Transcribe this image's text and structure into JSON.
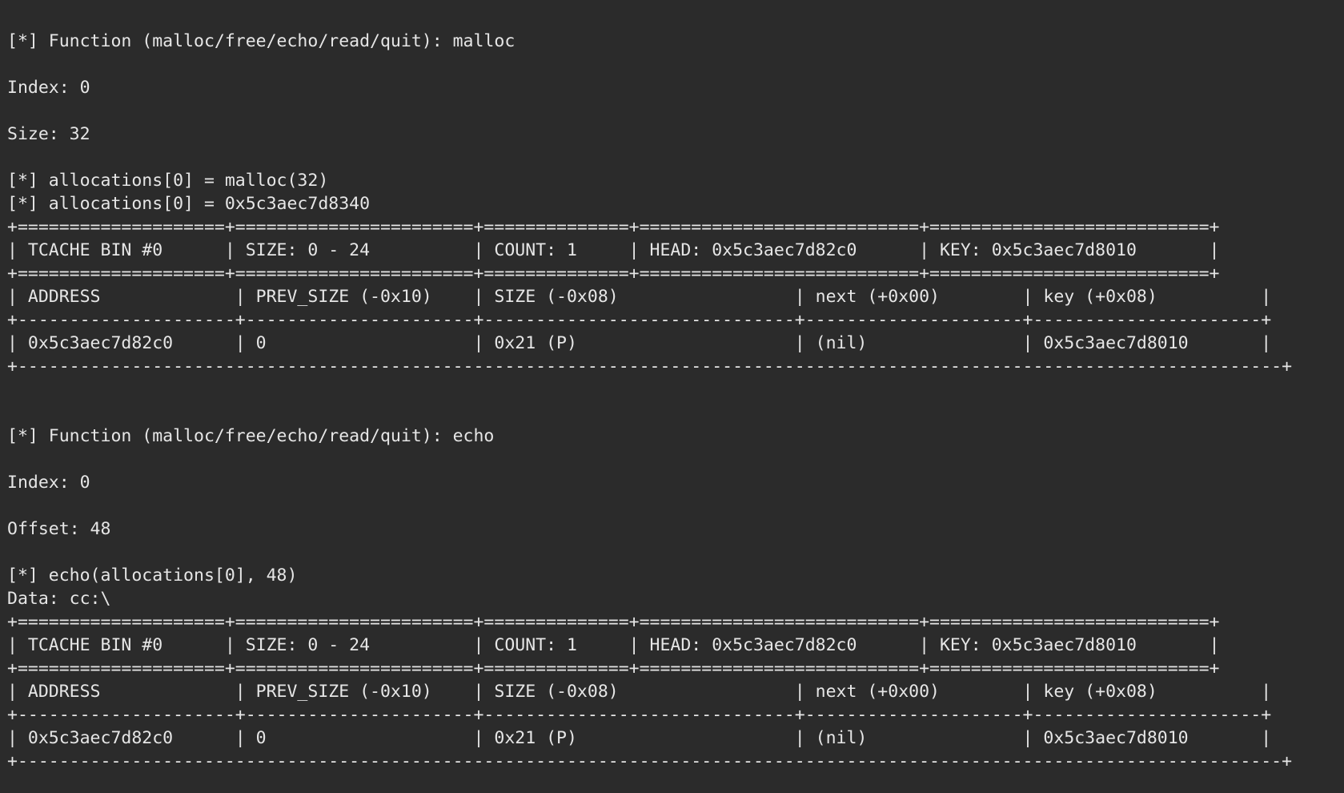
{
  "block1": {
    "prompt": "[*] Function (malloc/free/echo/read/quit): malloc",
    "index": "Index: 0",
    "size": "Size: 32",
    "call": "[*] allocations[0] = malloc(32)",
    "result": "[*] allocations[0] = 0x5c3aec7d8340",
    "table": {
      "border_top": "+====================+=======================+==============+===========================+===========================+",
      "header": "| TCACHE BIN #0      | SIZE: 0 - 24          | COUNT: 1     | HEAD: 0x5c3aec7d82c0      | KEY: 0x5c3aec7d8010       |",
      "border_mid": "+====================+=======================+==============+===========================+===========================+",
      "columns": "| ADDRESS             | PREV_SIZE (-0x10)    | SIZE (-0x08)                 | next (+0x00)        | key (+0x08)          |",
      "border_cols": "+---------------------+----------------------+------------------------------+---------------------+----------------------+",
      "row": "| 0x5c3aec7d82c0      | 0                    | 0x21 (P)                     | (nil)               | 0x5c3aec7d8010       |",
      "border_bottom": "+--------------------------------------------------------------------------------------------------------------------------+"
    }
  },
  "block2": {
    "prompt": "[*] Function (malloc/free/echo/read/quit): echo",
    "index": "Index: 0",
    "offset": "Offset: 48",
    "call": "[*] echo(allocations[0], 48)",
    "data": "Data: cc:\\",
    "table": {
      "border_top": "+====================+=======================+==============+===========================+===========================+",
      "header": "| TCACHE BIN #0      | SIZE: 0 - 24          | COUNT: 1     | HEAD: 0x5c3aec7d82c0      | KEY: 0x5c3aec7d8010       |",
      "border_mid": "+====================+=======================+==============+===========================+===========================+",
      "columns": "| ADDRESS             | PREV_SIZE (-0x10)    | SIZE (-0x08)                 | next (+0x00)        | key (+0x08)          |",
      "border_cols": "+---------------------+----------------------+------------------------------+---------------------+----------------------+",
      "row": "| 0x5c3aec7d82c0      | 0                    | 0x21 (P)                     | (nil)               | 0x5c3aec7d8010       |",
      "border_bottom": "+--------------------------------------------------------------------------------------------------------------------------+"
    }
  }
}
